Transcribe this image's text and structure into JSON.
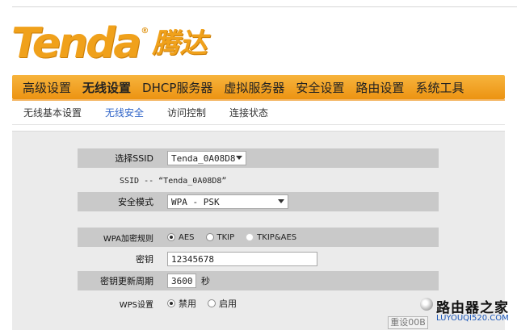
{
  "brand": {
    "logo_en": "Tenda",
    "logo_reg": "®",
    "logo_cn": "腾达"
  },
  "mainnav": {
    "items": [
      {
        "label": "高级设置"
      },
      {
        "label": "无线设置"
      },
      {
        "label": "DHCP服务器"
      },
      {
        "label": "虚拟服务器"
      },
      {
        "label": "安全设置"
      },
      {
        "label": "路由设置"
      },
      {
        "label": "系统工具"
      }
    ],
    "active": "无线设置"
  },
  "subnav": {
    "items": [
      {
        "label": "无线基本设置"
      },
      {
        "label": "无线安全"
      },
      {
        "label": "访问控制"
      },
      {
        "label": "连接状态"
      }
    ],
    "active": "无线安全"
  },
  "form": {
    "ssid_select": {
      "label": "选择SSID",
      "value": "Tenda_0A08D8"
    },
    "ssid_info": "SSID -- “Tenda_0A08D8”",
    "security_mode": {
      "label": "安全模式",
      "value": "WPA - PSK"
    },
    "wpa_cipher": {
      "label": "WPA加密规则",
      "options": [
        "AES",
        "TKIP",
        "TKIP&AES"
      ],
      "selected": "AES"
    },
    "key": {
      "label": "密钥",
      "value": "12345678"
    },
    "key_renewal": {
      "label": "密钥更新周期",
      "value": "3600",
      "unit": "秒"
    },
    "wps": {
      "label": "WPS设置",
      "options": [
        "禁用",
        "启用"
      ],
      "selected": "禁用"
    }
  },
  "footer": {
    "reset_label": "重设00B"
  },
  "watermark": {
    "cn": "路由器之家",
    "url": "LUYOUQI520.COM"
  },
  "colors": {
    "brand_orange": "#f0a11b",
    "nav_orange": "#ec9312",
    "active_sub": "#2e63c7"
  }
}
